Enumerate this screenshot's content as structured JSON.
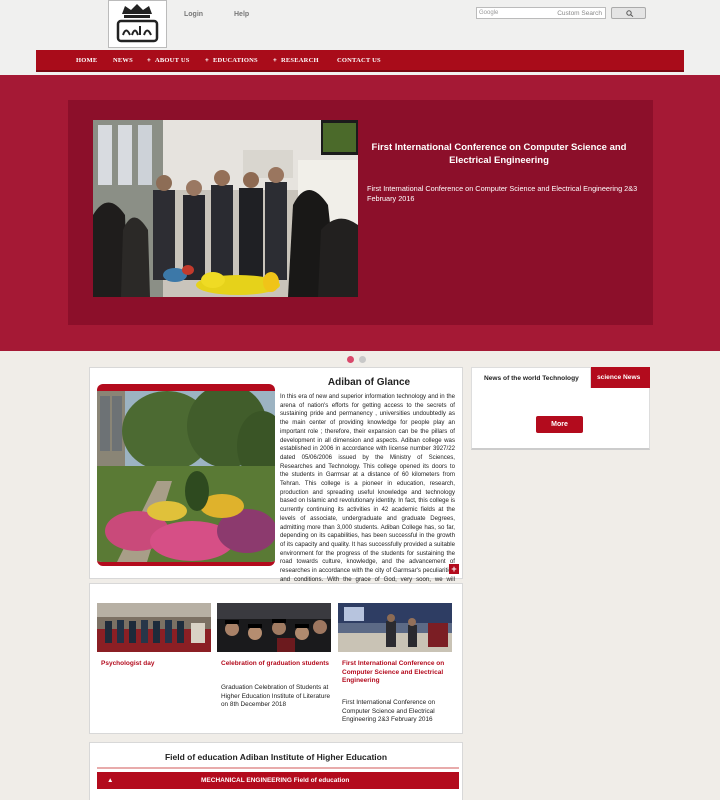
{
  "header": {
    "logo_text": "adbs",
    "login": "Login",
    "help": "Help",
    "search_placeholder": "Google",
    "search_label": "Custom Search"
  },
  "nav": {
    "items": [
      {
        "label": "HOME",
        "has_plus": false
      },
      {
        "label": "NEWS",
        "has_plus": false
      },
      {
        "label": "ABOUT US",
        "has_plus": true
      },
      {
        "label": "EDUCATIONS",
        "has_plus": true
      },
      {
        "label": "RESEARCH",
        "has_plus": true
      },
      {
        "label": "CONTACT US",
        "has_plus": false
      }
    ]
  },
  "slider": {
    "title": "First International Conference on Computer Science and Electrical Engineering",
    "description": "First International Conference on Computer Science and Electrical Engineering 2&3 February 2016",
    "active_slide": 1,
    "slide_count": 2
  },
  "glance": {
    "title": "Adiban of Glance",
    "body": "In this era of new and superior information technology and in the arena of nation's efforts for getting access to the secrets of sustaining pride and permanency , universities undoubtedly as the main center of providing knowledge for people play an important role ; therefore, their expansion can be the pillars of development in all dimension and aspects. Adiban college was established in 2006 in accordance with license number 3927/22 dated 05/06/2006 issued by the Ministry of Sciences, Researches and Technology. This college opened its doors to the students in Garmsar at a distance of 60 kilometers from Tehran. This college is a pioneer in education, research, production and spreading useful knowledge and technology based on Islamic and revolutionary identity. In fact, this college is currently continuing its activities in 42 academic fields at the levels of associate, undergraduate and graduate Degrees, admitting more than 3,000 students. Adiban College has, so far, depending on its capabilities, has been successful in the growth of its capacity and quality. It has successfully provided a suitable environment for the progress of the students for sustaining the road towards culture, knowledge, and the advancement of researches in accordance with the city of Garmsar's peculiarities and conditions. With the grace of God, very soon, we will witness the blossom of an Islamic Iran and the ever-increasing progress of Adiban College.",
    "more_symbol": "+"
  },
  "news": {
    "tab_world": "News of the world Technology",
    "tab_science": "science News",
    "more_button": "More"
  },
  "events": [
    {
      "title": "Psychologist day",
      "description": ""
    },
    {
      "title": "Celebration of graduation students",
      "description": "Graduation Celebration of Students at Higher Education Institute of Literature on 8th December 2018"
    },
    {
      "title": "First International Conference on Computer Science and Electrical Engineering",
      "description": "First International Conference on Computer Science and Electrical Engineering 2&3 February 2016"
    }
  ],
  "fields": {
    "title": "Field of education Adiban Institute of Higher Education",
    "first_field": "MECHANICAL ENGINEERING Field of education",
    "arrow": "▲"
  },
  "colors": {
    "brand_red": "#a90c1a",
    "slider_band": "#a51935",
    "slider_box": "#8c0f2a",
    "dot_active": "#d9486b",
    "dot_inactive": "#c8c8c8"
  }
}
